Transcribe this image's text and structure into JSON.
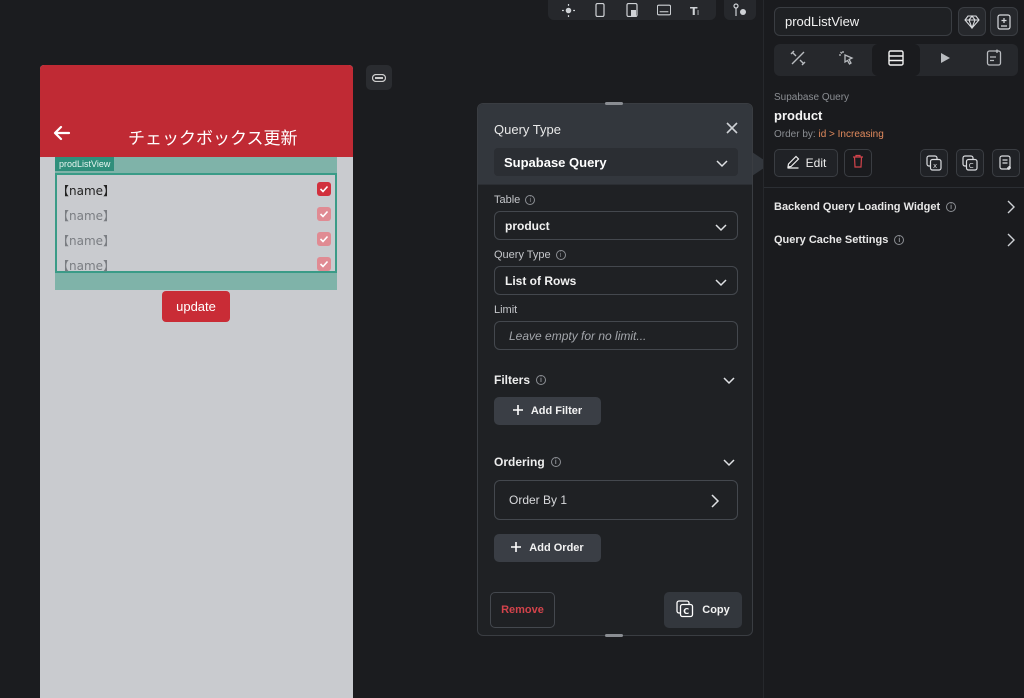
{
  "toolbar": {
    "icons": [
      "brightness-icon",
      "phone-icon",
      "tablet-icon",
      "keyboard-icon",
      "text-size-icon",
      "widget-settings-icon"
    ]
  },
  "canvas": {
    "app_title": "チェックボックス更新",
    "listview_tag": "prodListView",
    "rows": [
      {
        "label": "【name】",
        "checked": true,
        "dim": false
      },
      {
        "label": "【name】",
        "checked": true,
        "dim": true
      },
      {
        "label": "【name】",
        "checked": true,
        "dim": true
      },
      {
        "label": "【name】",
        "checked": true,
        "dim": true
      }
    ],
    "update_label": "update",
    "accent_color": "#c02a34"
  },
  "query_popup": {
    "title": "Query Type",
    "query_type_value": "Supabase Query",
    "table_label": "Table",
    "table_value": "product",
    "query_type_label": "Query Type",
    "query_type_rows": "List of Rows",
    "limit_label": "Limit",
    "limit_placeholder": "Leave empty for no limit...",
    "filters_label": "Filters",
    "add_filter_label": "Add Filter",
    "ordering_label": "Ordering",
    "order_by_label": "Order By 1",
    "add_order_label": "Add Order",
    "remove_label": "Remove",
    "copy_label": "Copy"
  },
  "right_panel": {
    "widget_name": "prodListView",
    "query_kind": "Supabase Query",
    "query_table": "product",
    "order_by_prefix": "Order by:",
    "order_by_value": "id > Increasing",
    "edit_label": "Edit",
    "backend_loading_label": "Backend Query Loading Widget",
    "cache_settings_label": "Query Cache Settings"
  }
}
